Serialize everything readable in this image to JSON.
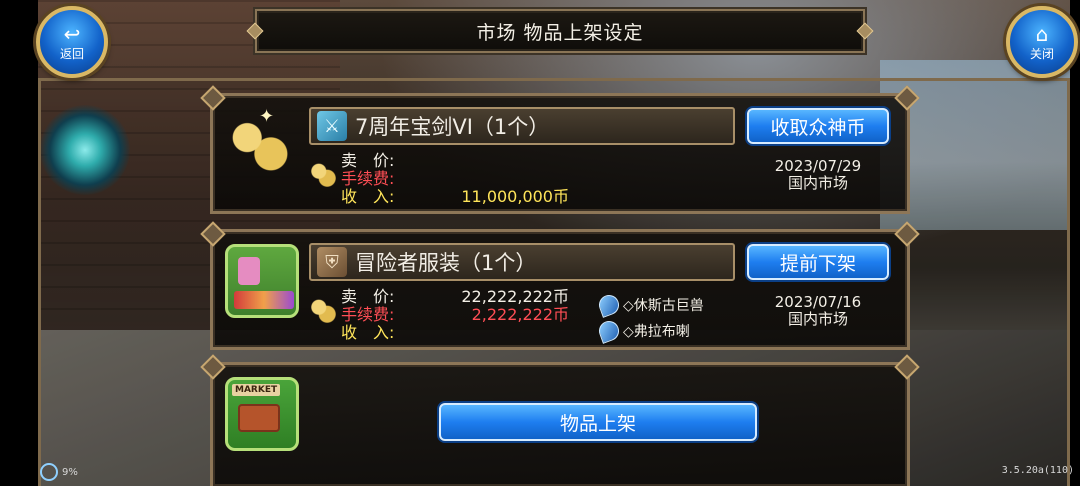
{
  "header": {
    "title": "市场 物品上架设定",
    "back_label": "返回",
    "close_label": "关闭",
    "back_icon": "return-arrow-icon",
    "close_icon": "home-icon"
  },
  "listings": [
    {
      "name": "7周年宝剑VI（1个）",
      "icon": "sword-icon",
      "art": "coins-icon",
      "action_label": "收取众神币",
      "sell_price_label": "卖　价:",
      "sell_price": "",
      "fee_label": "手续费:",
      "fee": "",
      "income_label": "收　入:",
      "income": "11,000,000币",
      "date": "2023/07/29",
      "market": "国内市场",
      "attributes": []
    },
    {
      "name": "冒险者服装（1个）",
      "icon": "armor-icon",
      "art": "shop-stall-icon",
      "action_label": "提前下架",
      "sell_price_label": "卖　价:",
      "sell_price": "22,222,222币",
      "fee_label": "手续费:",
      "fee": "2,222,222币",
      "income_label": "收　入:",
      "income": "",
      "date": "2023/07/16",
      "market": "国内市场",
      "attributes": [
        "◇休斯古巨兽",
        "◇弗拉布喇"
      ]
    }
  ],
  "new_listing": {
    "art_label": "MARKET",
    "button_label": "物品上架"
  },
  "status": {
    "battery": "9%",
    "version": "3.5.20a(110)"
  },
  "colors": {
    "fee_red": "#ff4e55",
    "income_yellow": "#ffe55a",
    "button_blue": "#1e7ef0",
    "frame_gold": "#8d7657"
  }
}
